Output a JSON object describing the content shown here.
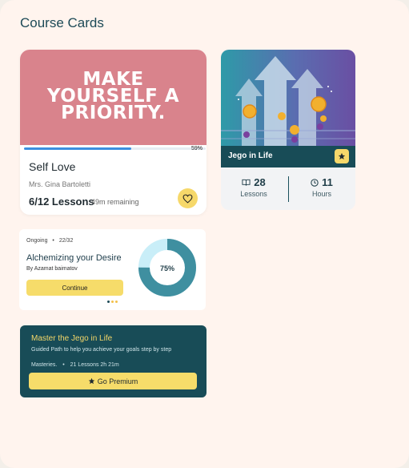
{
  "page": {
    "title": "Course Cards"
  },
  "self_love_card": {
    "hero_text": "MAKE YOURSELF A PRIORITY.",
    "progress_percent": 59,
    "progress_label": "59%",
    "title": "Self Love",
    "author": "Mrs. Gina Bartoletti",
    "lessons": "6/12 Lessons",
    "remaining": "49m remaining",
    "favorite_icon": "heart-icon"
  },
  "jego_card": {
    "caption": "Jego in Life",
    "badge_icon": "star-icon",
    "stats": [
      {
        "value": "28",
        "label": "Lessons",
        "icon": "book-icon"
      },
      {
        "value": "11",
        "label": "Hours",
        "icon": "clock-icon"
      }
    ]
  },
  "ongoing_card": {
    "status": "Ongoing",
    "count": "22/32",
    "title": "Alchemizing your Desire",
    "author": "By Azamat baimatov",
    "button_label": "Continue",
    "progress_percent": 75,
    "progress_label": "75%"
  },
  "premium_card": {
    "title": "Master the Jego in Life",
    "subtitle": "Guided Path to help you achieve your goals step by step",
    "meta_left": "Masteries.",
    "meta_right": "21 Lessons 2h 21m",
    "button_label": "Go Premium"
  },
  "colors": {
    "background": "#fff4ee",
    "accent_yellow": "#f6dc6a",
    "teal_dark": "#184c57",
    "teal_ring": "#3f8fa0",
    "hero_pink": "#d9838c",
    "progress_blue": "#3b8fe0"
  }
}
